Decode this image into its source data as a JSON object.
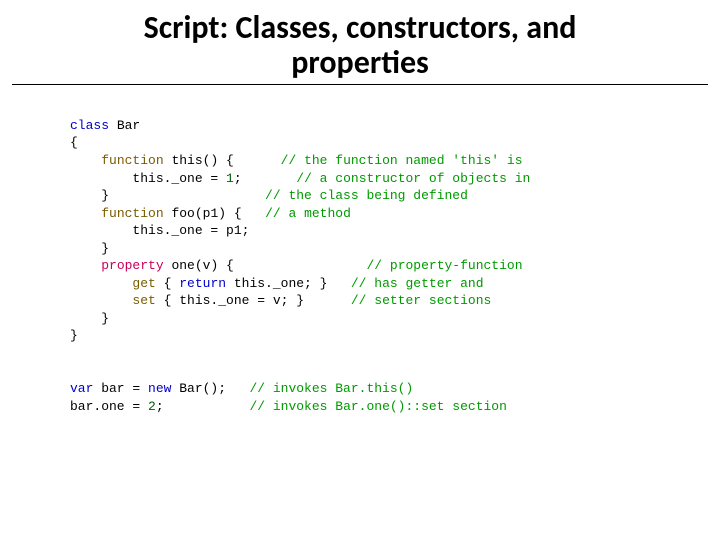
{
  "title": "Script: Classes, constructors, and properties",
  "code": {
    "l1": {
      "kw": "class",
      "rest": " Bar"
    },
    "l2": "{",
    "l3": {
      "pad": "    ",
      "kw": "function",
      "sig": " this() {      ",
      "cmt": "// the function named 'this' is"
    },
    "l4": {
      "pad": "        ",
      "stmt": "this._one = ",
      "num": "1",
      "semi": ";       ",
      "cmt": "// a constructor of objects in"
    },
    "l5": {
      "pad": "    ",
      "brace": "}                    ",
      "cmt": "// the class being defined"
    },
    "l6": {
      "pad": "    ",
      "kw": "function",
      "sig": " foo(p1) {   ",
      "cmt": "// a method"
    },
    "l7": {
      "pad": "        ",
      "stmt": "this._one = p1;"
    },
    "l8": {
      "pad": "    ",
      "brace": "}"
    },
    "l9": {
      "pad": "    ",
      "kw": "property",
      "sig": " one(v) {                 ",
      "cmt": "// property-function"
    },
    "l10": {
      "pad": "        ",
      "kw": "get",
      "body": " { ",
      "ret": "return",
      "expr": " this._one; }   ",
      "cmt": "// has getter and"
    },
    "l11": {
      "pad": "        ",
      "kw": "set",
      "body": " { this._one = v; }      ",
      "cmt": "// setter sections"
    },
    "l12": {
      "pad": "    ",
      "brace": "}"
    },
    "l13": "}",
    "blank": " ",
    "l15": {
      "kw1": "var",
      "mid": " bar = ",
      "kw2": "new",
      "rest": " Bar();   ",
      "cmt": "// invokes Bar.this()"
    },
    "l16": {
      "stmt": "bar.one = ",
      "num": "2",
      "semi": ";           ",
      "cmt": "// invokes Bar.one()::set section"
    }
  }
}
